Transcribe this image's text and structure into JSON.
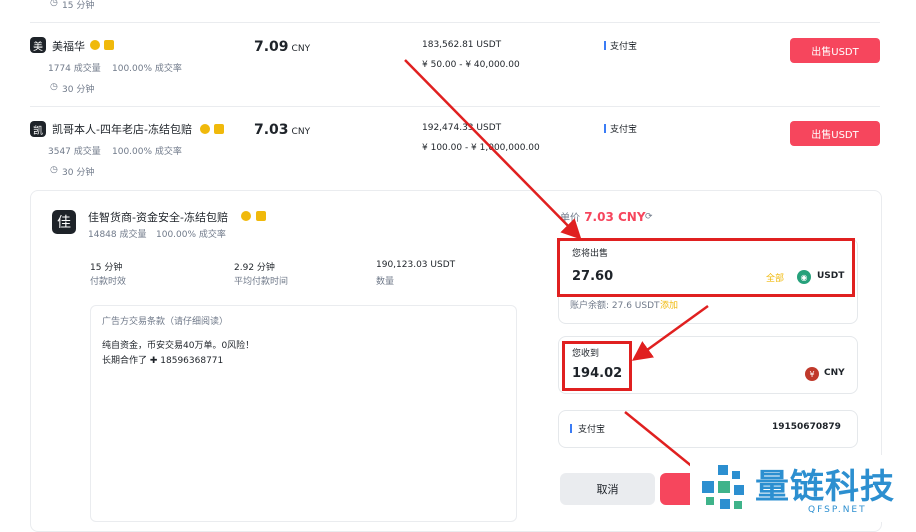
{
  "top_fragment": {
    "time_limit": "15 分钟"
  },
  "ads": [
    {
      "avatar_letter": "美",
      "name": "美福华",
      "orders": "1774 成交量",
      "completion": "100.00% 成交率",
      "time_limit": "30 分钟",
      "price": "7.09",
      "currency": "CNY",
      "available": "183,562.81 USDT",
      "limit": "¥ 50.00 - ¥ 40,000.00",
      "payment": "支付宝",
      "action": "出售USDT"
    },
    {
      "avatar_letter": "凯",
      "name": "凯哥本人-四年老店-冻结包赔",
      "orders": "3547 成交量",
      "completion": "100.00% 成交率",
      "time_limit": "30 分钟",
      "price": "7.03",
      "currency": "CNY",
      "available": "192,474.33 USDT",
      "limit": "¥ 100.00 - ¥ 1,000,000.00",
      "payment": "支付宝",
      "action": "出售USDT"
    }
  ],
  "detail": {
    "avatar_letter": "佳",
    "merchant_name": "佳智货商-资金安全-冻结包赔",
    "orders": "14848 成交量",
    "completion": "100.00% 成交率",
    "stats": [
      {
        "value": "15 分钟",
        "label": "付款时效"
      },
      {
        "value": "2.92 分钟",
        "label": "平均付款时间"
      },
      {
        "value": "190,123.03 USDT",
        "label": "数量"
      }
    ],
    "terms_title": "广告方交易条款（请仔细阅读）",
    "terms_line1": "纯自资金，币安交易40万单。0风险！",
    "terms_line2": "长期合作了 ✚ 18596368771"
  },
  "order": {
    "price_prefix": "单价",
    "price": "7.03 CNY",
    "sell_label": "您将出售",
    "sell_amount": "27.60",
    "all_link": "全部",
    "sell_currency": "USDT",
    "balance_text": "账户余额: 27.6 USDT",
    "add_link": "添加",
    "receive_label": "您收到",
    "receive_amount": "194.02",
    "receive_currency": "CNY",
    "payment_method": "支付宝",
    "payment_account": "19150670879",
    "cancel_label": "取消"
  },
  "watermark": {
    "title": "量链科技",
    "domain": "QFSP.NET"
  },
  "colors": {
    "sell_red": "#f6465d",
    "annotation_red": "#e02020",
    "gold": "#f0b90b",
    "usdt_teal": "#26a17b",
    "logo_blue": "#2c8fd0"
  }
}
